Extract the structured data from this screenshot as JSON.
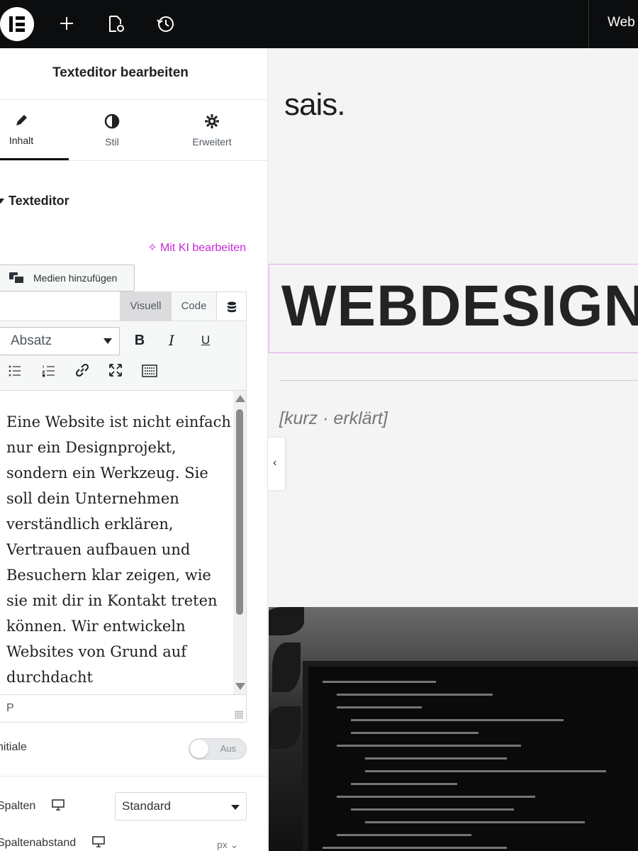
{
  "topbar": {
    "title": "Web",
    "icons": [
      "elementor-logo-icon",
      "plus-icon",
      "page-settings-icon",
      "history-icon"
    ]
  },
  "panel": {
    "title": "Texteditor bearbeiten",
    "tabs": [
      {
        "label": "Inhalt",
        "icon": "pencil-icon",
        "active": true
      },
      {
        "label": "Stil",
        "icon": "half-circle-icon",
        "active": false
      },
      {
        "label": "Erweitert",
        "icon": "gear-icon",
        "active": false
      }
    ],
    "section": "Texteditor",
    "ki_link": "Mit KI bearbeiten",
    "media_button": "Medien hinzufügen",
    "editor_tabs": {
      "visual": "Visuell",
      "code": "Code"
    },
    "format_select": "Absatz",
    "format_buttons": {
      "bold": "B",
      "italic": "I",
      "underline": "U"
    },
    "content": "Eine Website ist nicht einfach nur ein Designprojekt, sondern ein Werkzeug. Sie soll dein Unternehmen verständlich erklären, Vertrauen aufbauen und Besuchern klar zeigen, wie sie mit dir in Kontakt treten können. Wir entwickeln Websites von Grund auf durchdacht",
    "status_path": "P",
    "initiale_label": "nitiale",
    "initiale_toggle": "Aus",
    "spalten_label": "Spalten",
    "spalten_value": "Standard",
    "spaltenabstand_label": "Spaltenabstand",
    "spaltenabstand_unit": "px ⌄"
  },
  "canvas": {
    "brand": "sais.",
    "headline": "WEBDESIGN",
    "subtitle": "[kurz · erklärt]"
  },
  "colors": {
    "topbar_bg": "#0c0d0e",
    "ki_accent": "#c62ad8",
    "selection_border": "#e5a4f0"
  }
}
